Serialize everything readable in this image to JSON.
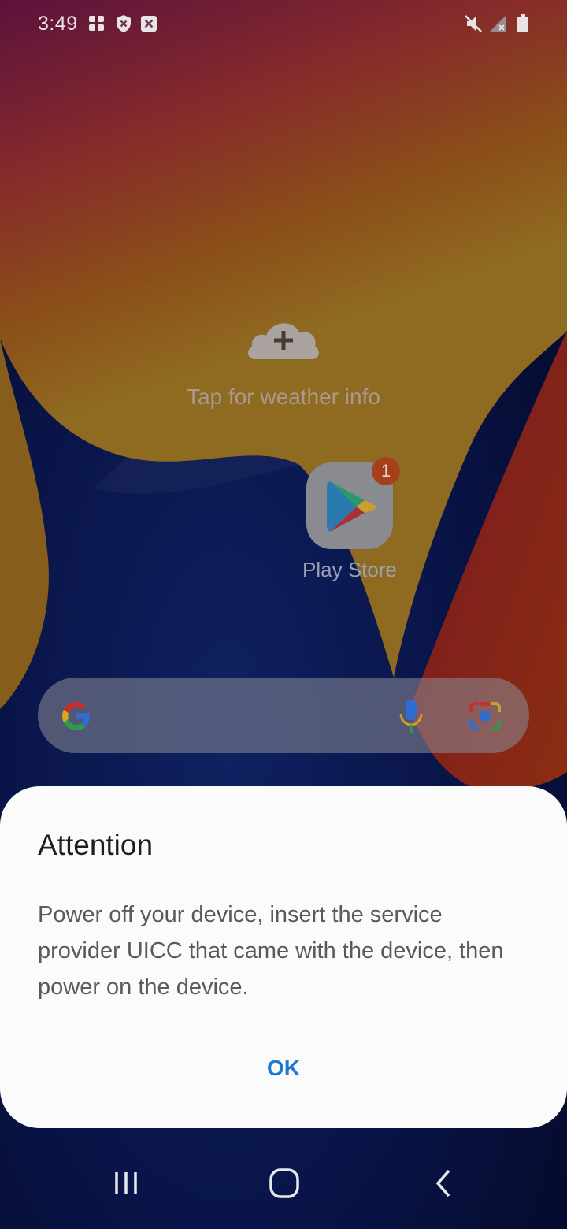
{
  "status_bar": {
    "time": "3:49",
    "left_icons": [
      "apps-icon",
      "shield-icon",
      "close-box-icon"
    ],
    "right_icons": [
      "mute-icon",
      "signal-off-icon",
      "battery-icon"
    ]
  },
  "weather": {
    "text": "Tap for weather info",
    "icon": "cloud-plus-icon"
  },
  "apps": [
    {
      "label": "Play Store",
      "icon": "play-store-icon",
      "badge": "1"
    }
  ],
  "search_bar": {
    "icons": [
      "google-g-icon",
      "microphone-icon",
      "camera-lens-icon"
    ]
  },
  "dialog": {
    "title": "Attention",
    "message": "Power off your device, insert the service provider UICC that came with the device, then power on the device.",
    "ok_label": "OK"
  },
  "nav_bar": {
    "buttons": [
      "recents-button",
      "home-button",
      "back-button"
    ]
  },
  "colors": {
    "accent": "#1d79d3",
    "dialog_bg": "#fbfbfb"
  }
}
